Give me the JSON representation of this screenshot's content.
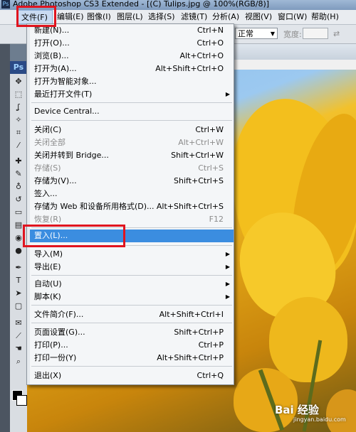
{
  "window": {
    "title": "Adobe Photoshop CS3 Extended - [(C) Tulips.jpg @ 100%(RGB/8)]"
  },
  "menubar": [
    {
      "label": "文件(F)"
    },
    {
      "label": "编辑(E)"
    },
    {
      "label": "图像(I)"
    },
    {
      "label": "图层(L)"
    },
    {
      "label": "选择(S)"
    },
    {
      "label": "滤镜(T)"
    },
    {
      "label": "分析(A)"
    },
    {
      "label": "视图(V)"
    },
    {
      "label": "窗口(W)"
    },
    {
      "label": "帮助(H)"
    }
  ],
  "options_bar": {
    "style_value": "正常",
    "width_label": "宽度:",
    "swap_icon": "swap-icon"
  },
  "toolbox": {
    "badge": "Ps",
    "icons": [
      "move-icon",
      "marquee-icon",
      "lasso-icon",
      "wand-icon",
      "crop-icon",
      "slice-icon",
      "healing-icon",
      "brush-icon",
      "stamp-icon",
      "history-brush-icon",
      "eraser-icon",
      "gradient-icon",
      "blur-icon",
      "dodge-icon",
      "pen-icon",
      "type-icon",
      "path-select-icon",
      "shape-icon",
      "notes-icon",
      "eyedropper-icon",
      "hand-icon",
      "zoom-icon"
    ],
    "foreground_color": "#000000",
    "background_color": "#ffffff"
  },
  "file_menu": {
    "items": [
      {
        "label": "新建(N)...",
        "shortcut": "Ctrl+N",
        "enabled": true
      },
      {
        "label": "打开(O)...",
        "shortcut": "Ctrl+O",
        "enabled": true
      },
      {
        "label": "浏览(B)...",
        "shortcut": "Alt+Ctrl+O",
        "enabled": true
      },
      {
        "label": "打开为(A)...",
        "shortcut": "Alt+Shift+Ctrl+O",
        "enabled": true
      },
      {
        "label": "打开为智能对象...",
        "shortcut": "",
        "enabled": true
      },
      {
        "label": "最近打开文件(T)",
        "shortcut": "",
        "enabled": true,
        "submenu": true
      },
      {
        "label": "Device Central...",
        "shortcut": "",
        "enabled": true
      },
      {
        "label": "关闭(C)",
        "shortcut": "Ctrl+W",
        "enabled": true
      },
      {
        "label": "关闭全部",
        "shortcut": "Alt+Ctrl+W",
        "enabled": false
      },
      {
        "label": "关闭并转到 Bridge...",
        "shortcut": "Shift+Ctrl+W",
        "enabled": true
      },
      {
        "label": "存储(S)",
        "shortcut": "Ctrl+S",
        "enabled": false
      },
      {
        "label": "存储为(V)...",
        "shortcut": "Shift+Ctrl+S",
        "enabled": true
      },
      {
        "label": "签入...",
        "shortcut": "",
        "enabled": true
      },
      {
        "label": "存储为 Web 和设备所用格式(D)...",
        "shortcut": "Alt+Shift+Ctrl+S",
        "enabled": true
      },
      {
        "label": "恢复(R)",
        "shortcut": "F12",
        "enabled": false
      },
      {
        "label": "置入(L)...",
        "shortcut": "",
        "enabled": true,
        "highlighted": true
      },
      {
        "label": "导入(M)",
        "shortcut": "",
        "enabled": true,
        "submenu": true
      },
      {
        "label": "导出(E)",
        "shortcut": "",
        "enabled": true,
        "submenu": true
      },
      {
        "label": "自动(U)",
        "shortcut": "",
        "enabled": true,
        "submenu": true
      },
      {
        "label": "脚本(K)",
        "shortcut": "",
        "enabled": true,
        "submenu": true
      },
      {
        "label": "文件简介(F)...",
        "shortcut": "Alt+Shift+Ctrl+I",
        "enabled": true
      },
      {
        "label": "页面设置(G)...",
        "shortcut": "Shift+Ctrl+P",
        "enabled": true
      },
      {
        "label": "打印(P)...",
        "shortcut": "Ctrl+P",
        "enabled": true
      },
      {
        "label": "打印一份(Y)",
        "shortcut": "Alt+Shift+Ctrl+P",
        "enabled": true
      },
      {
        "label": "退出(X)",
        "shortcut": "Ctrl+Q",
        "enabled": true
      }
    ]
  },
  "watermark": {
    "text": "Bai 经验",
    "subtext": "jingyan.baidu.com"
  },
  "colors": {
    "highlight": "#3b8de0",
    "annotation": "#e0141f"
  }
}
